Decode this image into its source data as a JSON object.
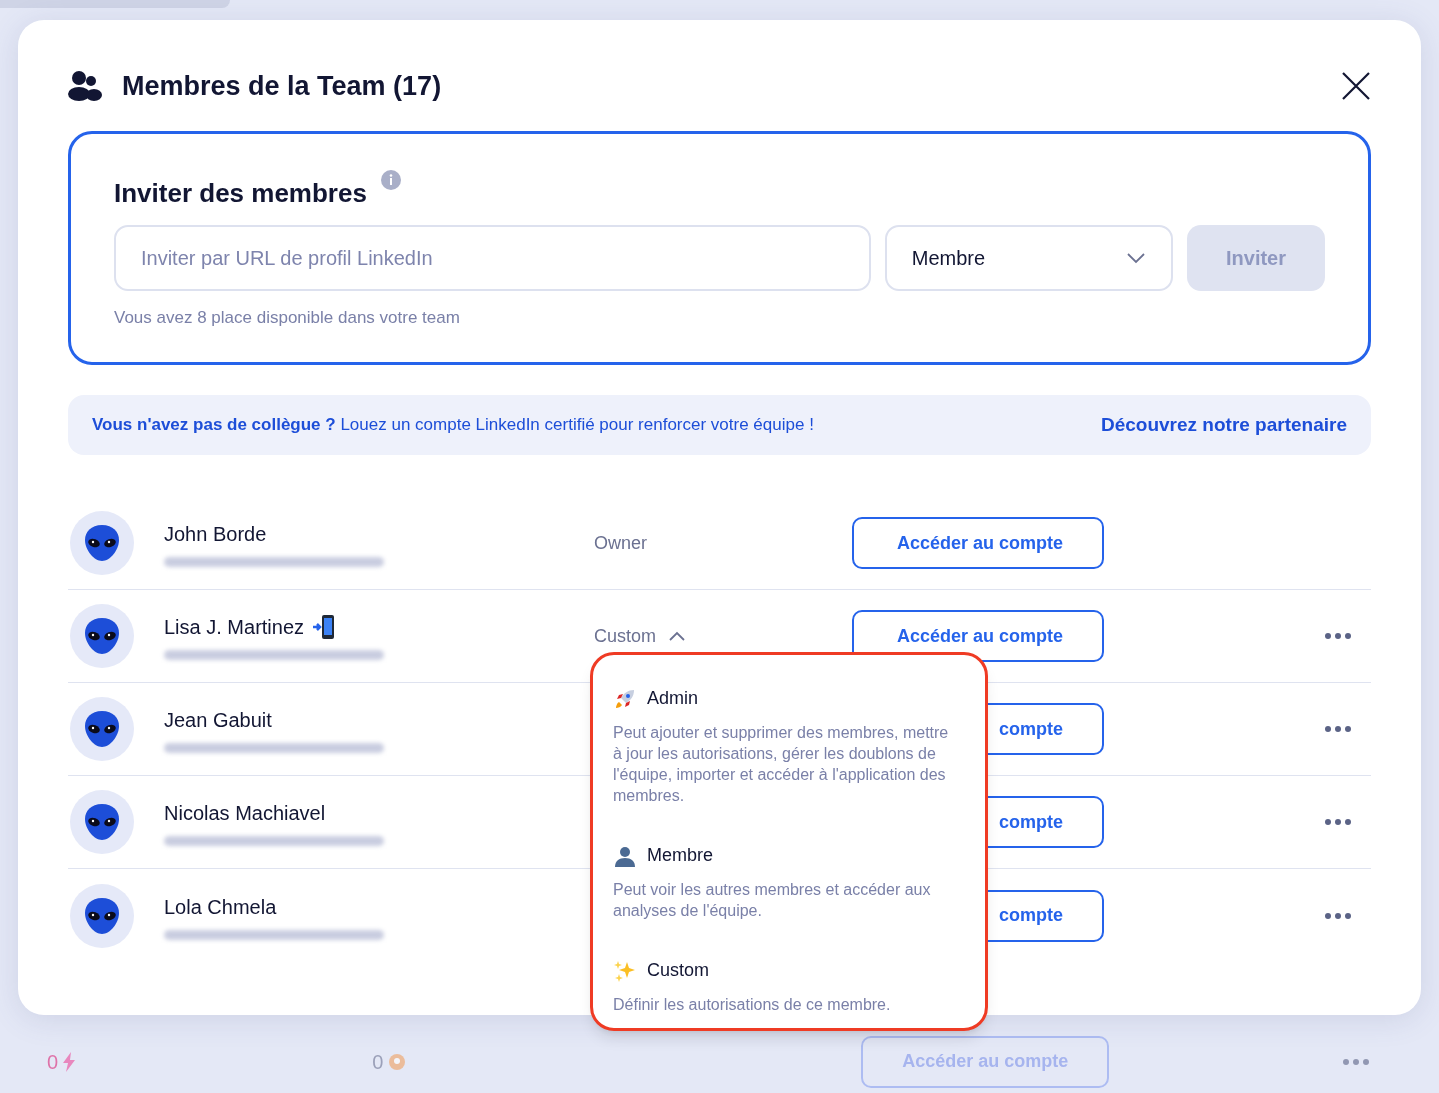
{
  "dialog": {
    "title": "Membres de la Team (17)"
  },
  "invite": {
    "title": "Inviter des membres",
    "placeholder": "Inviter par URL de profil LinkedIn",
    "role": "Membre",
    "button": "Inviter",
    "button_disabled": true,
    "note": "Vous avez 8 place disponible dans votre team"
  },
  "banner": {
    "text": "**Vous n'avez pas de collègue ?** Louez un compte LinkedIn certifié pour renforcer votre équipe !",
    "link": "Découvrez notre partenaire"
  },
  "members": [
    {
      "name": "John Borde",
      "phone_icon": false,
      "role": "Owner",
      "role_menu": false,
      "expanded": false,
      "button": "Accéder au compte",
      "more_menu": false
    },
    {
      "name": "Lisa J. Martinez",
      "phone_icon": true,
      "role": "Custom",
      "role_menu": true,
      "expanded": true,
      "button": "Accéder au compte",
      "more_menu": true
    },
    {
      "name": "Jean Gabuit",
      "phone_icon": false,
      "button": "compte",
      "more_menu": true
    },
    {
      "name": "Nicolas Machiavel",
      "phone_icon": false,
      "button": "compte",
      "more_menu": true
    },
    {
      "name": "Lola Chmela",
      "phone_icon": false,
      "button": "compte",
      "more_menu": true
    }
  ],
  "role_dropdown": [
    {
      "kind": "admin",
      "label": "Admin",
      "description": "Peut ajouter et supprimer des membres, mettre à jour les autorisations, gérer les doublons de l'équipe, importer et accéder à l'application des membres."
    },
    {
      "kind": "member",
      "label": "Membre",
      "description": "Peut voir les autres membres et accéder aux analyses de l'équipe."
    },
    {
      "kind": "custom",
      "label": "Custom",
      "description": "Définir les autorisations de ce membre."
    }
  ],
  "background_row": {
    "count_1": "0",
    "count_2": "0",
    "button": "Accéder au compte"
  }
}
